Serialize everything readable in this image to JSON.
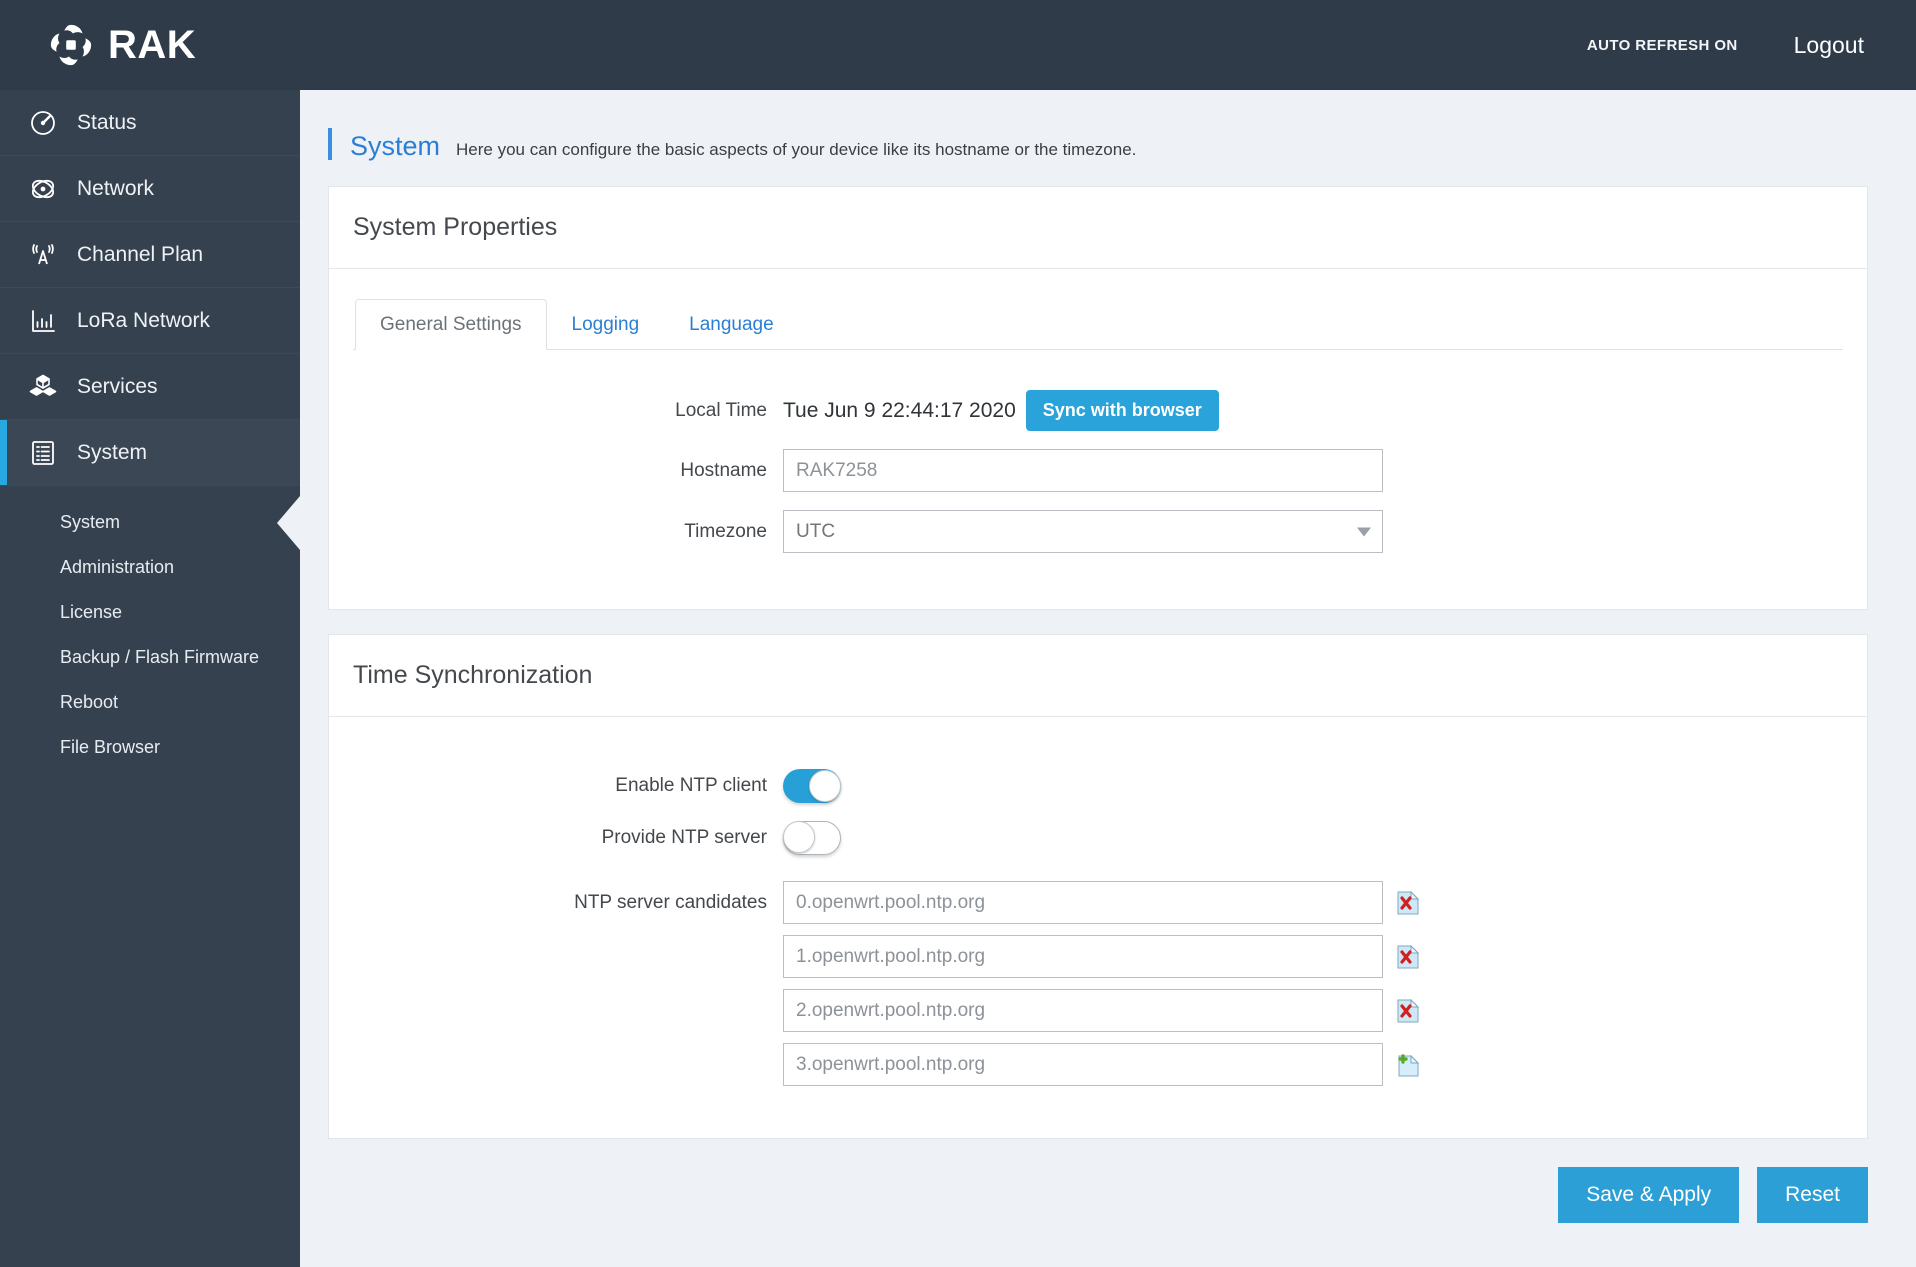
{
  "topbar": {
    "brand": "RAK",
    "auto_refresh": "AUTO REFRESH ON",
    "logout": "Logout"
  },
  "sidebar": {
    "items": [
      {
        "label": "Status",
        "icon": "speedometer-icon",
        "active": false
      },
      {
        "label": "Network",
        "icon": "network-atom-icon",
        "active": false
      },
      {
        "label": "Channel Plan",
        "icon": "antenna-icon",
        "active": false
      },
      {
        "label": "LoRa Network",
        "icon": "bar-chart-icon",
        "active": false
      },
      {
        "label": "Services",
        "icon": "boxes-icon",
        "active": false
      },
      {
        "label": "System",
        "icon": "list-panel-icon",
        "active": true
      }
    ],
    "submenu": [
      {
        "label": "System",
        "selected": true
      },
      {
        "label": "Administration",
        "selected": false
      },
      {
        "label": "License",
        "selected": false
      },
      {
        "label": "Backup / Flash Firmware",
        "selected": false
      },
      {
        "label": "Reboot",
        "selected": false
      },
      {
        "label": "File Browser",
        "selected": false
      }
    ]
  },
  "page": {
    "title": "System",
    "description": "Here you can configure the basic aspects of your device like its hostname or the timezone."
  },
  "system_properties": {
    "card_title": "System Properties",
    "tabs": [
      {
        "label": "General Settings",
        "active": true
      },
      {
        "label": "Logging",
        "active": false
      },
      {
        "label": "Language",
        "active": false
      }
    ],
    "local_time_label": "Local Time",
    "local_time_value": "Tue Jun 9 22:44:17 2020",
    "sync_button": "Sync with browser",
    "hostname_label": "Hostname",
    "hostname_placeholder": "RAK7258",
    "hostname_value": "",
    "timezone_label": "Timezone",
    "timezone_placeholder": "UTC",
    "timezone_value": ""
  },
  "time_sync": {
    "card_title": "Time Synchronization",
    "enable_ntp_label": "Enable NTP client",
    "enable_ntp_state": "on",
    "provide_ntp_label": "Provide NTP server",
    "provide_ntp_state": "off",
    "candidates_label": "NTP server candidates",
    "candidates": [
      {
        "placeholder": "0.openwrt.pool.ntp.org",
        "value": "",
        "action": "remove"
      },
      {
        "placeholder": "1.openwrt.pool.ntp.org",
        "value": "",
        "action": "remove"
      },
      {
        "placeholder": "2.openwrt.pool.ntp.org",
        "value": "",
        "action": "remove"
      },
      {
        "placeholder": "3.openwrt.pool.ntp.org",
        "value": "",
        "action": "add"
      }
    ]
  },
  "footer": {
    "save_label": "Save & Apply",
    "reset_label": "Reset"
  },
  "colors": {
    "brand_dark": "#303b49",
    "sidebar": "#36414f",
    "accent_blue": "#27a8e0",
    "link_blue": "#2a7fd4",
    "page_bg": "#eef1f5"
  }
}
